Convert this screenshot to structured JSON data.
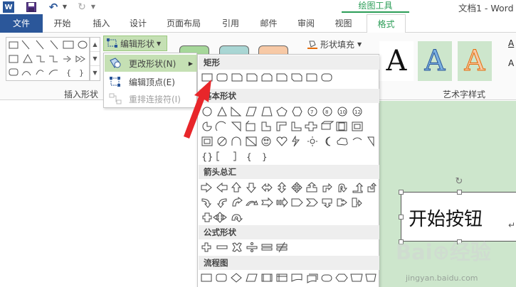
{
  "title_bar": {
    "app_logo": "W",
    "window_title": "文档1 - Word",
    "contextual_tab_group": "绘图工具"
  },
  "tabs": [
    {
      "label": "文件"
    },
    {
      "label": "开始"
    },
    {
      "label": "插入"
    },
    {
      "label": "设计"
    },
    {
      "label": "页面布局"
    },
    {
      "label": "引用"
    },
    {
      "label": "邮件"
    },
    {
      "label": "审阅"
    },
    {
      "label": "视图"
    },
    {
      "label": "格式"
    }
  ],
  "ribbon": {
    "edit_shape_label": "编辑形状",
    "shape_fill_label": "形状填充",
    "insert_shapes_group": "插入形状",
    "wordart_group": "艺术字样式",
    "wordart_glyph": "A",
    "wordart_side": [
      "A",
      "A"
    ],
    "style_colors": [
      "#a6d79a",
      "#a9d6d4",
      "#f7c9a6"
    ]
  },
  "submenu": {
    "change_shape": "更改形状(N)",
    "edit_points": "编辑顶点(E)",
    "reroute": "重排连接符(I)"
  },
  "shapes_panel": {
    "categories": [
      "矩形",
      "基本形状",
      "箭头总汇",
      "公式形状",
      "流程图"
    ]
  },
  "document": {
    "textbox_text": "开始按钮",
    "paragraph_mark": "↵"
  },
  "watermark": {
    "logo": "Bai⊕经验",
    "site": "jingyan.baidu.com"
  },
  "colors": {
    "file_tab": "#2b579a",
    "accent_green": "#2b9d57",
    "highlight_green": "#c5e0b4",
    "doc_green": "#cde6cc",
    "arrow_red": "#e8262a"
  }
}
